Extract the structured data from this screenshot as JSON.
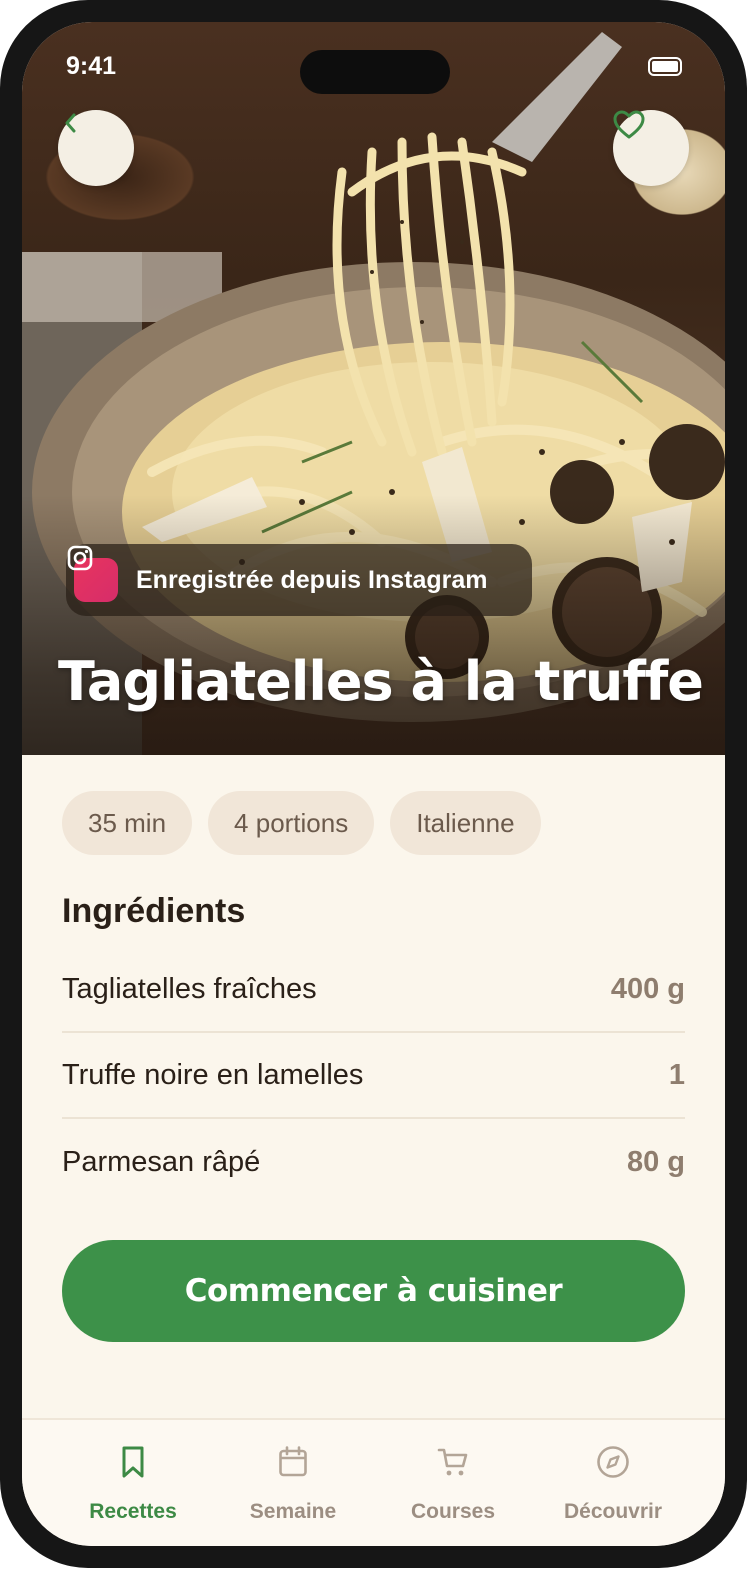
{
  "status_bar": {
    "time": "9:41"
  },
  "hero": {
    "source_label": "Enregistrée depuis Instagram",
    "title": "Tagliatelles à la truffe"
  },
  "tags": [
    "35 min",
    "4 portions",
    "Italienne"
  ],
  "ingredients": {
    "title": "Ingrédients",
    "items": [
      {
        "name": "Tagliatelles fraîches",
        "qty": "400 g"
      },
      {
        "name": "Truffe noire en lamelles",
        "qty": "1"
      },
      {
        "name": "Parmesan râpé",
        "qty": "80 g"
      }
    ]
  },
  "cta": {
    "label": "Commencer à cuisiner"
  },
  "tabbar": {
    "items": [
      {
        "label": "Recettes",
        "icon": "bookmark-icon",
        "active": true
      },
      {
        "label": "Semaine",
        "icon": "calendar-icon",
        "active": false
      },
      {
        "label": "Courses",
        "icon": "cart-icon",
        "active": false
      },
      {
        "label": "Découvrir",
        "icon": "compass-icon",
        "active": false
      }
    ]
  },
  "colors": {
    "accent_green": "#3d9149",
    "active_tab": "#3d8a45",
    "inactive_tab": "#9c8e82",
    "background": "#fbf6ec",
    "tag_background": "#f1e6d8",
    "instagram": "#e8345e"
  }
}
